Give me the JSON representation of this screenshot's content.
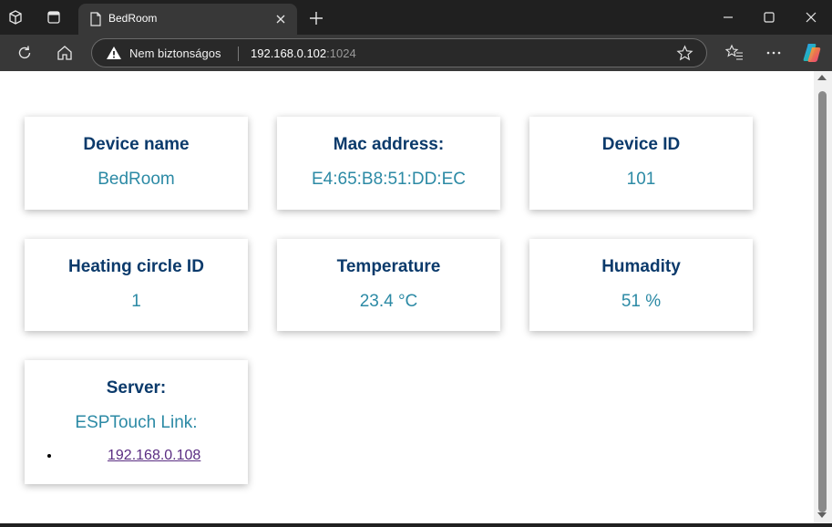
{
  "browser": {
    "tab_title": "BedRoom",
    "security_label": "Nem biztonságos",
    "url_host": "192.168.0.102",
    "url_port": ":1024"
  },
  "cards": [
    {
      "title": "Device name",
      "value": "BedRoom"
    },
    {
      "title": "Mac address:",
      "value": "E4:65:B8:51:DD:EC"
    },
    {
      "title": "Device ID",
      "value": "101"
    },
    {
      "title": "Heating circle ID",
      "value": "1"
    },
    {
      "title": "Temperature",
      "value": "23.4 °C"
    },
    {
      "title": "Humadity",
      "value": "51 %"
    }
  ],
  "server": {
    "title": "Server:",
    "subtitle": "ESPTouch Link:",
    "link_text": "192.168.0.108"
  },
  "colors": {
    "card_title": "#0b3a6b",
    "card_value": "#2c8aa5",
    "link": "#5a2d82",
    "browser_frame": "#202020",
    "toolbar": "#383838"
  },
  "icons": [
    "workspaces-icon",
    "tab-actions-icon",
    "page-icon",
    "close-icon",
    "plus-icon",
    "minimize-icon",
    "maximize-icon",
    "refresh-icon",
    "home-icon",
    "warning-icon",
    "star-icon",
    "favorites-icon",
    "more-icon",
    "copilot-icon"
  ]
}
